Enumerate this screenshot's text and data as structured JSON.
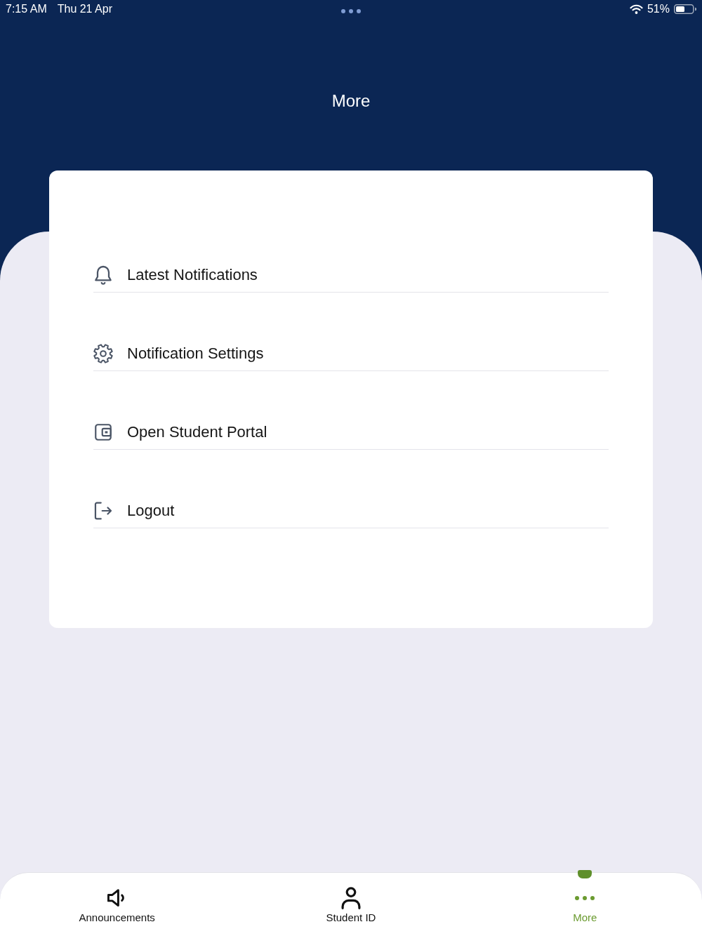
{
  "status_bar": {
    "time": "7:15 AM",
    "date": "Thu 21 Apr",
    "battery": "51%"
  },
  "header": {
    "title": "More"
  },
  "menu": {
    "items": [
      {
        "kind": "bell",
        "label": "Latest Notifications"
      },
      {
        "kind": "gear",
        "label": "Notification Settings"
      },
      {
        "kind": "wallet",
        "label": "Open Student Portal"
      },
      {
        "kind": "logout",
        "label": "Logout"
      }
    ]
  },
  "tab_bar": {
    "tabs": [
      {
        "kind": "speaker",
        "label": "Announcements",
        "selected": false
      },
      {
        "kind": "person",
        "label": "Student ID",
        "selected": false
      },
      {
        "kind": "dots",
        "label": "More",
        "selected": true
      }
    ]
  }
}
